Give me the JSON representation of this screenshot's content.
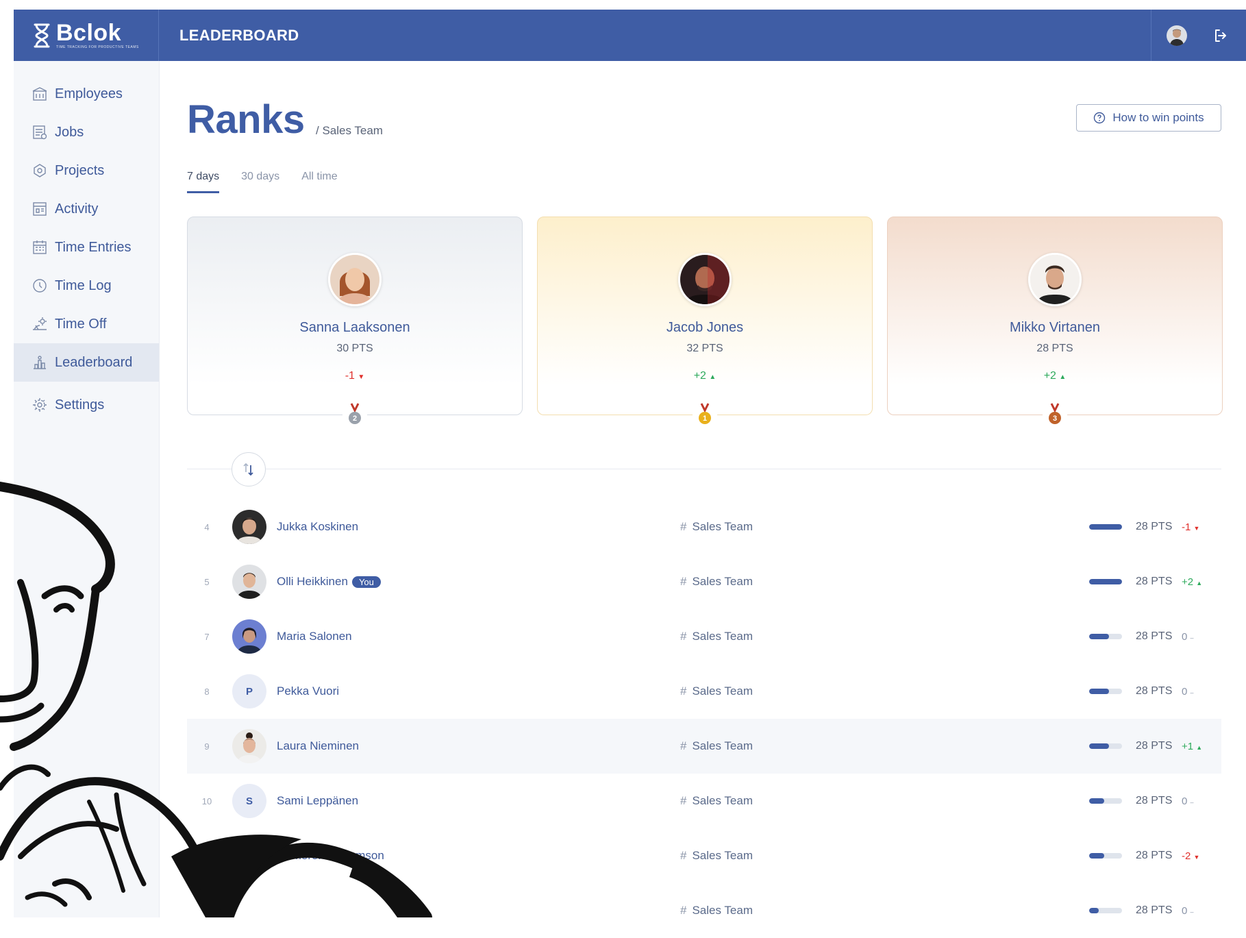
{
  "app": {
    "name": "Bclok",
    "tagline": "TIME TRACKING FOR PRODUCTIVE TEAMS"
  },
  "header": {
    "title": "LEADERBOARD",
    "avatar_icon": "user-avatar",
    "logout_icon": "logout-icon"
  },
  "sidebar": {
    "items": [
      {
        "label": "Employees",
        "icon": "employees-icon",
        "active": false
      },
      {
        "label": "Jobs",
        "icon": "jobs-icon",
        "active": false
      },
      {
        "label": "Projects",
        "icon": "projects-icon",
        "active": false
      },
      {
        "label": "Activity",
        "icon": "activity-icon",
        "active": false
      },
      {
        "label": "Time Entries",
        "icon": "time-entries-icon",
        "active": false
      },
      {
        "label": "Time Log",
        "icon": "clock-icon",
        "active": false
      },
      {
        "label": "Time Off",
        "icon": "beach-icon",
        "active": false
      },
      {
        "label": "Leaderboard",
        "icon": "leaderboard-icon",
        "active": true
      },
      {
        "label": "Settings",
        "icon": "gear-icon",
        "active": false
      }
    ]
  },
  "page": {
    "title": "Ranks",
    "subtitle": "/ Sales Team",
    "how_button": "How to win points",
    "tabs": [
      {
        "label": "7 days",
        "active": true
      },
      {
        "label": "30 days",
        "active": false
      },
      {
        "label": "All time",
        "active": false
      }
    ]
  },
  "podium": [
    {
      "name": "Sanna Laaksonen",
      "points": "30 PTS",
      "change": "-1",
      "direction": "down",
      "place": "2",
      "medal_color": "#9aa1ab"
    },
    {
      "name": "Jacob Jones",
      "points": "32 PTS",
      "change": "+2",
      "direction": "up",
      "place": "1",
      "medal_color": "#e9b01c"
    },
    {
      "name": "Mikko Virtanen",
      "points": "28 PTS",
      "change": "+2",
      "direction": "up",
      "place": "3",
      "medal_color": "#c0622a"
    }
  ],
  "leaderboard": [
    {
      "rank": "4",
      "name": "Jukka Koskinen",
      "team": "Sales Team",
      "points": "28 PTS",
      "change": "-1",
      "direction": "down",
      "progress": 1.0,
      "initial": "",
      "you": ""
    },
    {
      "rank": "5",
      "name": "Olli Heikkinen",
      "team": "Sales Team",
      "points": "28 PTS",
      "change": "+2",
      "direction": "up",
      "progress": 1.0,
      "initial": "",
      "you": "You"
    },
    {
      "rank": "7",
      "name": "Maria Salonen",
      "team": "Sales Team",
      "points": "28 PTS",
      "change": "0",
      "direction": "flat",
      "progress": 0.6,
      "initial": "",
      "you": ""
    },
    {
      "rank": "8",
      "name": "Pekka Vuori",
      "team": "Sales Team",
      "points": "28 PTS",
      "change": "0",
      "direction": "flat",
      "progress": 0.6,
      "initial": "P",
      "you": ""
    },
    {
      "rank": "9",
      "name": "Laura Nieminen",
      "team": "Sales Team",
      "points": "28 PTS",
      "change": "+1",
      "direction": "up",
      "progress": 0.6,
      "initial": "",
      "you": ""
    },
    {
      "rank": "10",
      "name": "Sami Leppänen",
      "team": "Sales Team",
      "points": "28 PTS",
      "change": "0",
      "direction": "flat",
      "progress": 0.45,
      "initial": "S",
      "you": ""
    },
    {
      "rank": "",
      "name": "Cameron Williamson",
      "team": "Sales Team",
      "points": "28 PTS",
      "change": "-2",
      "direction": "down",
      "progress": 0.45,
      "initial": "",
      "you": ""
    },
    {
      "rank": "",
      "name": "",
      "team": "Sales Team",
      "points": "28 PTS",
      "change": "0",
      "direction": "flat",
      "progress": 0.3,
      "initial": "",
      "you": ""
    }
  ],
  "colors": {
    "primary": "#3f5da5",
    "up": "#2eaa5c",
    "down": "#e0302c",
    "sidebar_bg": "#f5f7fa"
  }
}
